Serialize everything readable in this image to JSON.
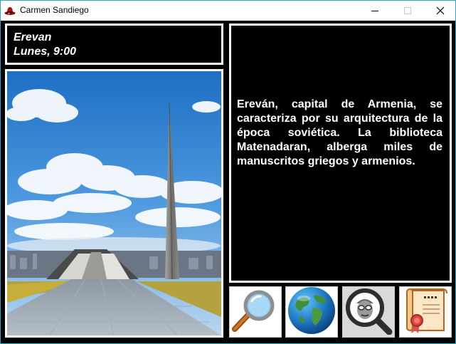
{
  "window": {
    "title": "Carmen Sandiego",
    "controls": [
      "minimize-icon",
      "maximize-icon",
      "close-icon"
    ]
  },
  "location": {
    "city": "Erevan",
    "datetime": "Lunes, 9:00"
  },
  "description": "Ereván, capital de Armenia, se caracteriza por su arquitectura de la época soviética. La biblioteca Matenadaran, alberga miles de manuscritos griegos y armenios.",
  "actions": [
    {
      "icon": "magnifying-glass-icon"
    },
    {
      "icon": "globe-icon"
    },
    {
      "icon": "suspect-search-icon"
    },
    {
      "icon": "warrant-certificate-icon"
    }
  ],
  "colors": {
    "background": "#000000",
    "panel_border": "#ffffff",
    "text": "#ffffff",
    "window_border": "#2aa7c9"
  }
}
